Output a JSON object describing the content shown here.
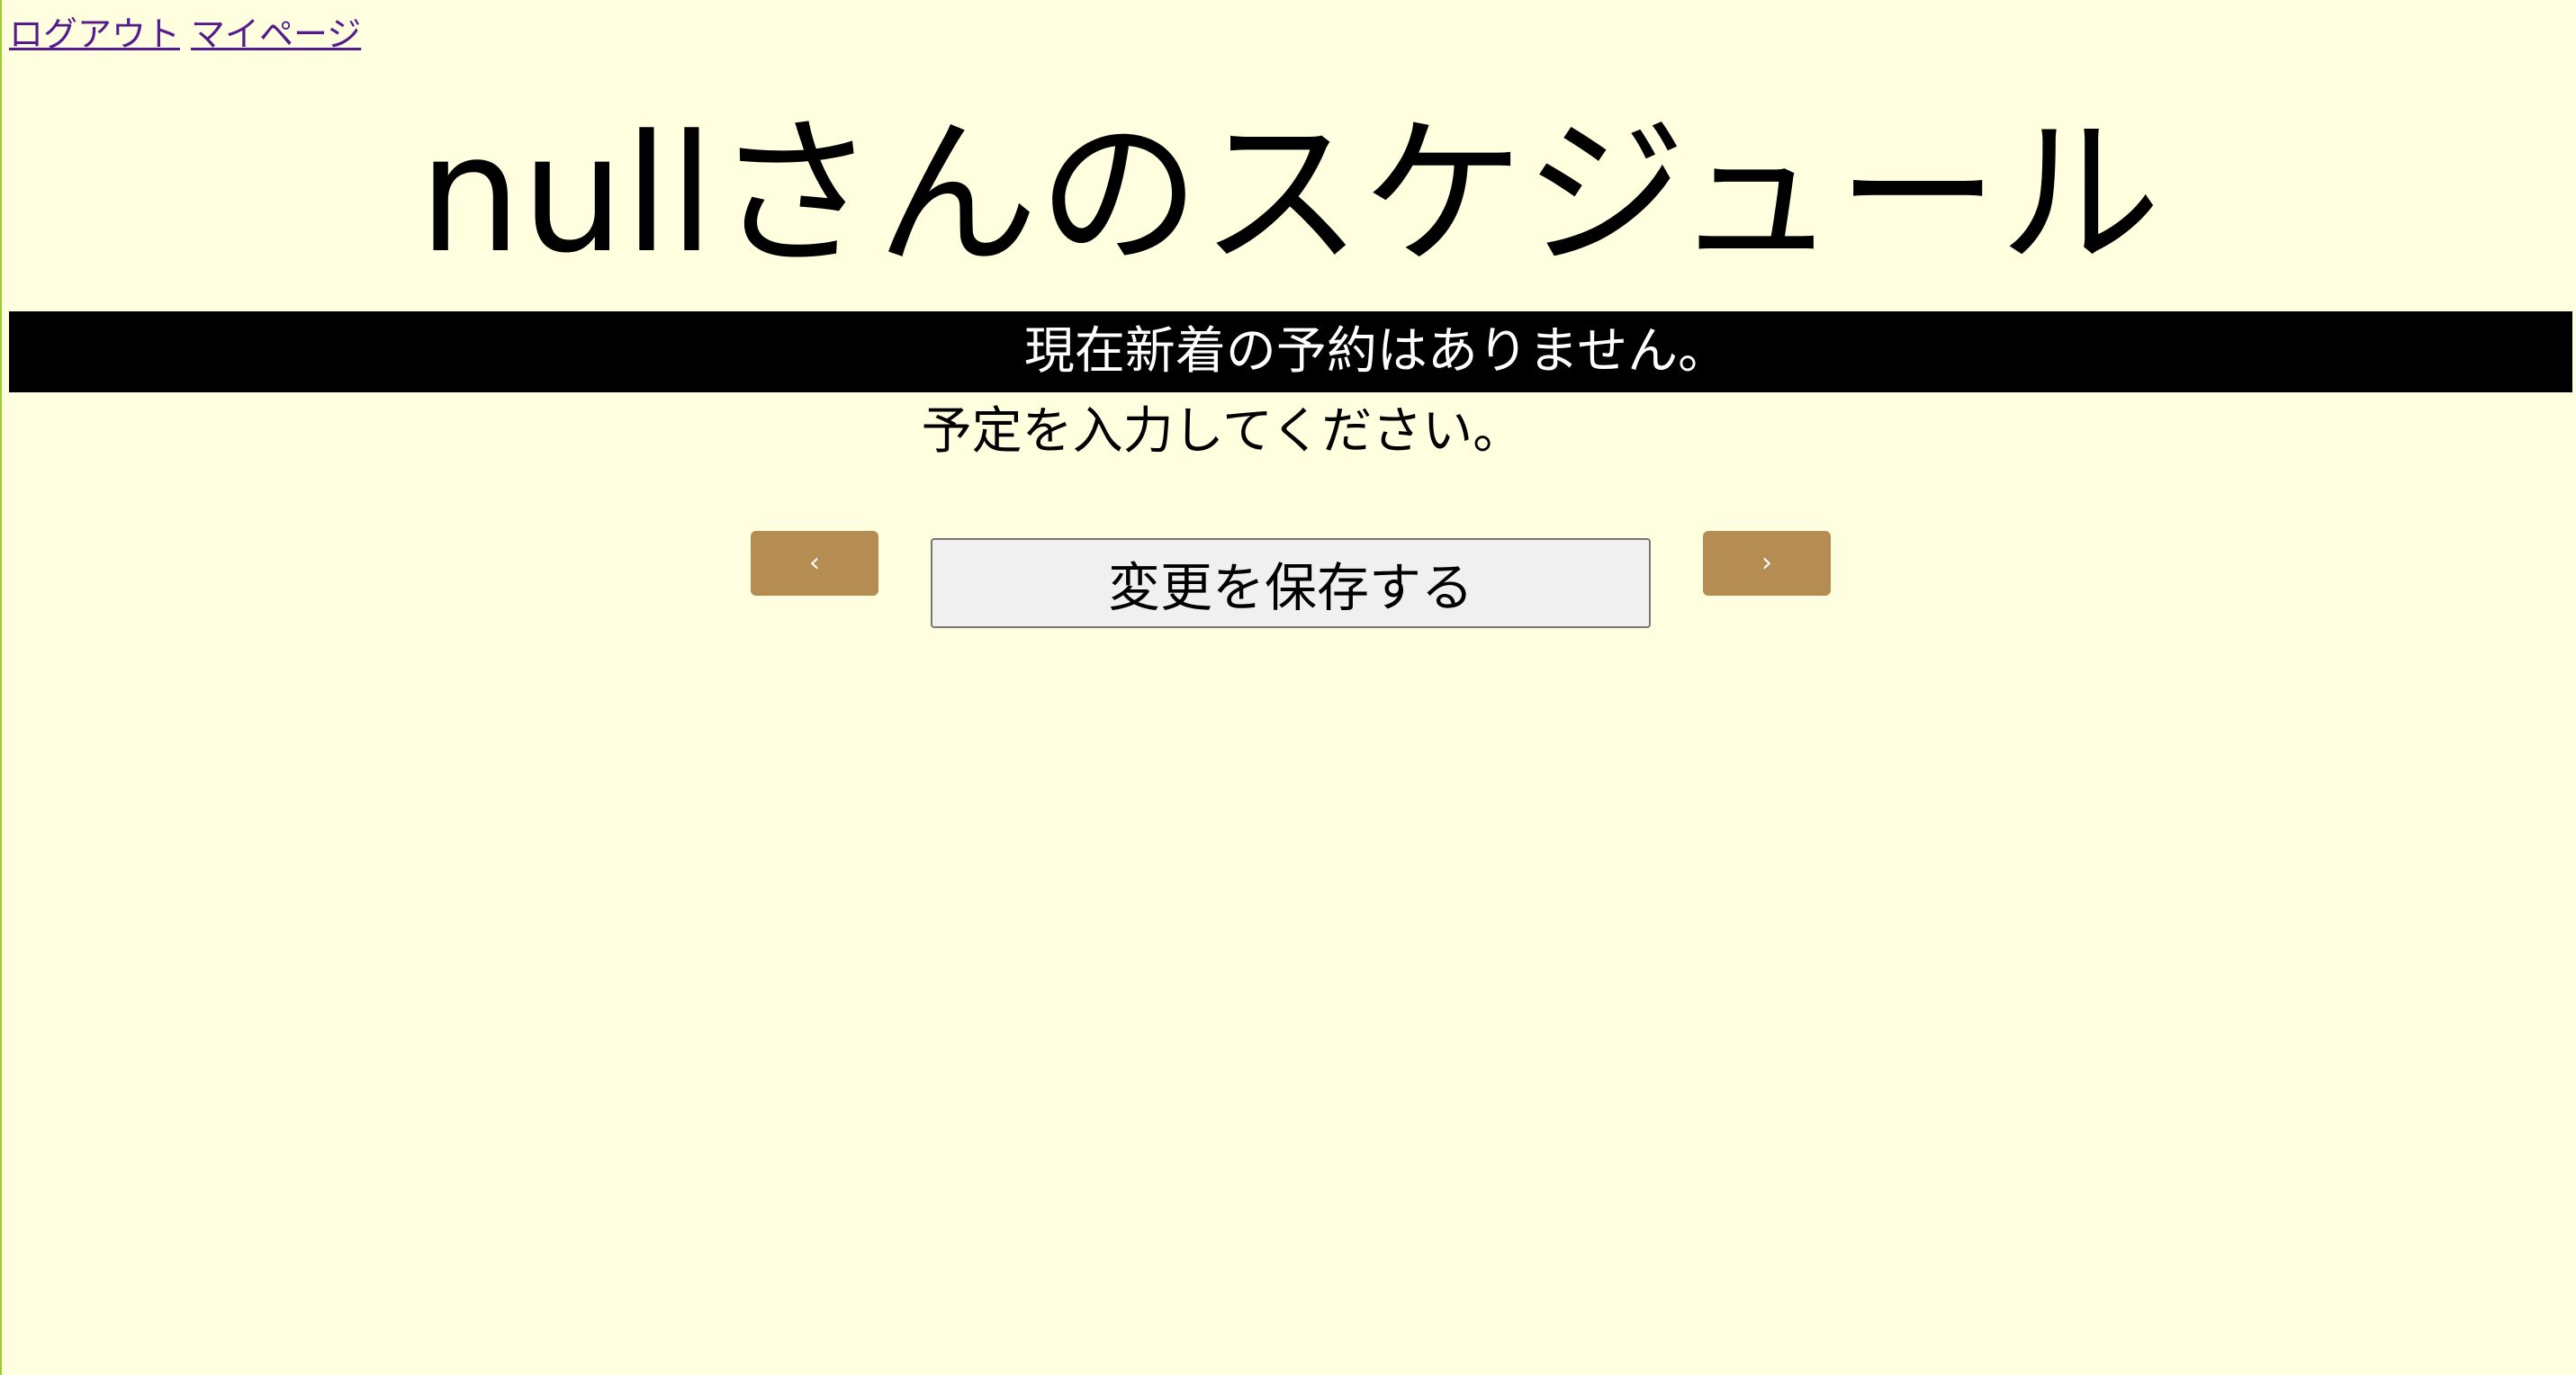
{
  "nav": {
    "logout_label": "ログアウト",
    "mypage_label": "マイページ"
  },
  "header": {
    "title": "nullさんのスケジュール"
  },
  "notice": {
    "text": "現在新着の予約はありません。"
  },
  "instruction": {
    "text": "予定を入力してください。"
  },
  "controls": {
    "prev_label": "‹",
    "save_label": "変更を保存する",
    "next_label": "›"
  },
  "colors": {
    "background": "#ffffe0",
    "nav_button": "#b58d52",
    "notice_bar": "#000000",
    "link": "#551a8b"
  }
}
